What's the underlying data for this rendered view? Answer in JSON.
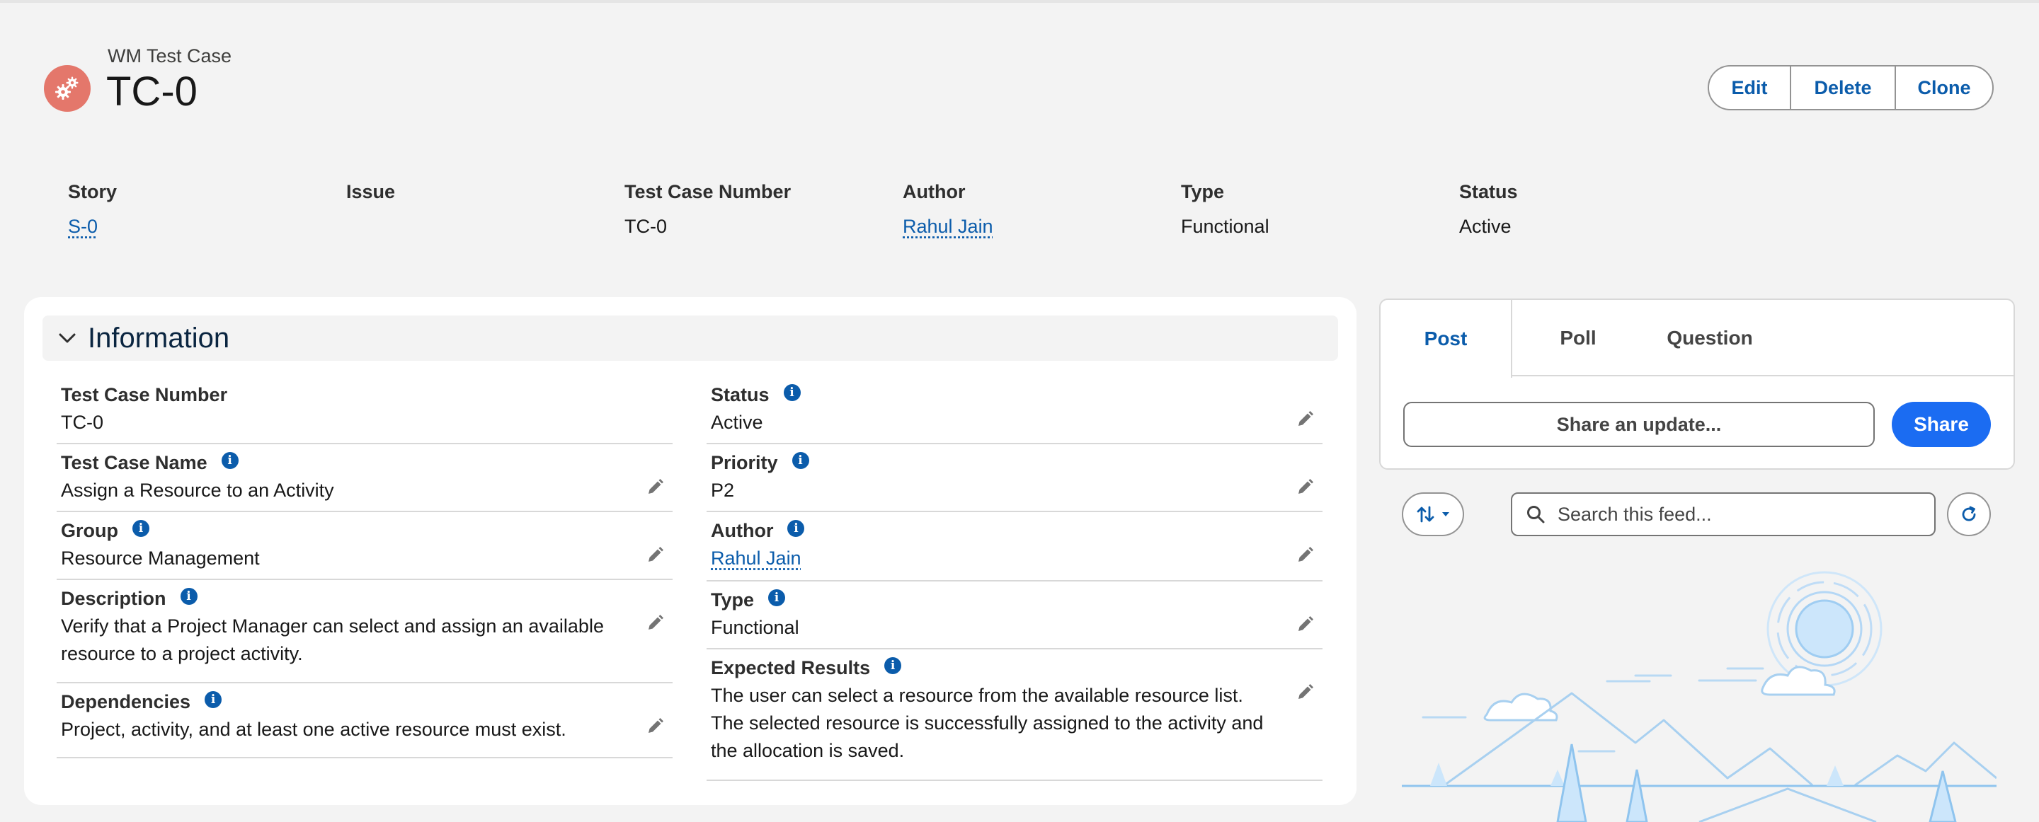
{
  "header": {
    "object_type": "WM Test Case",
    "record_title": "TC-0",
    "actions": {
      "edit": "Edit",
      "delete": "Delete",
      "clone": "Clone"
    },
    "icon": "gears-icon",
    "icon_color": "#e4776b"
  },
  "highlights": [
    {
      "label": "Story",
      "value": "S-0",
      "is_link": true
    },
    {
      "label": "Issue",
      "value": "",
      "is_link": false
    },
    {
      "label": "Test Case Number",
      "value": "TC-0",
      "is_link": false
    },
    {
      "label": "Author",
      "value": "Rahul Jain",
      "is_link": true
    },
    {
      "label": "Type",
      "value": "Functional",
      "is_link": false
    },
    {
      "label": "Status",
      "value": "Active",
      "is_link": false
    }
  ],
  "information": {
    "title": "Information",
    "left": {
      "test_case_number": {
        "label": "Test Case Number",
        "value": "TC-0"
      },
      "test_case_name": {
        "label": "Test Case Name",
        "value": "Assign a Resource to an Activity"
      },
      "group": {
        "label": "Group",
        "value": "Resource Management"
      },
      "description": {
        "label": "Description",
        "value": "Verify that a Project Manager can select and assign an available resource to a project activity."
      },
      "dependencies": {
        "label": "Dependencies",
        "value": "Project, activity, and at least one active resource must exist."
      }
    },
    "right": {
      "status": {
        "label": "Status",
        "value": "Active"
      },
      "priority": {
        "label": "Priority",
        "value": "P2"
      },
      "author": {
        "label": "Author",
        "value": "Rahul Jain"
      },
      "type": {
        "label": "Type",
        "value": "Functional"
      },
      "expected_results": {
        "label": "Expected Results",
        "value": "The user can select a resource from the available resource list. The selected resource is successfully assigned to the activity and the allocation is saved."
      }
    }
  },
  "publisher": {
    "tabs": {
      "post": "Post",
      "poll": "Poll",
      "question": "Question"
    },
    "share_placeholder": "Share an update...",
    "share_button": "Share"
  },
  "feed": {
    "search_placeholder": "Search this feed..."
  },
  "colors": {
    "brand_blue": "#0b5cab",
    "share_button": "#1b6cf2",
    "background": "#f3f3f3"
  }
}
